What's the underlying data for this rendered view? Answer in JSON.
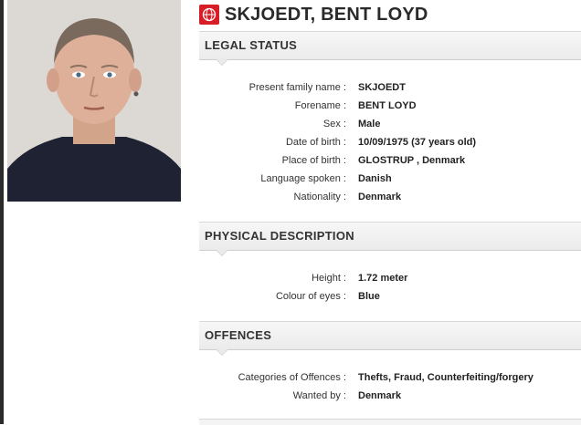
{
  "person": {
    "full_name": "SKJOEDT, BENT LOYD"
  },
  "sections": {
    "legal_status": {
      "title": "LEGAL STATUS",
      "fields": [
        {
          "label": "Present family name :",
          "value": "SKJOEDT"
        },
        {
          "label": "Forename :",
          "value": "BENT LOYD"
        },
        {
          "label": "Sex :",
          "value": "Male"
        },
        {
          "label": "Date of birth :",
          "value": "10/09/1975 (37 years old)"
        },
        {
          "label": "Place of birth :",
          "value": "GLOSTRUP , Denmark"
        },
        {
          "label": "Language spoken :",
          "value": "Danish"
        },
        {
          "label": "Nationality :",
          "value": "Denmark"
        }
      ]
    },
    "physical_description": {
      "title": "PHYSICAL DESCRIPTION",
      "fields": [
        {
          "label": "Height :",
          "value": "1.72 meter"
        },
        {
          "label": "Colour of eyes :",
          "value": "Blue"
        }
      ]
    },
    "offences": {
      "title": "OFFENCES",
      "fields": [
        {
          "label": "Categories of Offences :",
          "value": "Thefts, Fraud, Counterfeiting/forgery"
        },
        {
          "label": "Wanted by :",
          "value": "Denmark"
        }
      ]
    }
  },
  "colors": {
    "logo_red": "#d71e28",
    "header_bg": "#ebebeb",
    "text": "#222222"
  },
  "icons": {
    "logo": "interpol-globe-icon"
  }
}
